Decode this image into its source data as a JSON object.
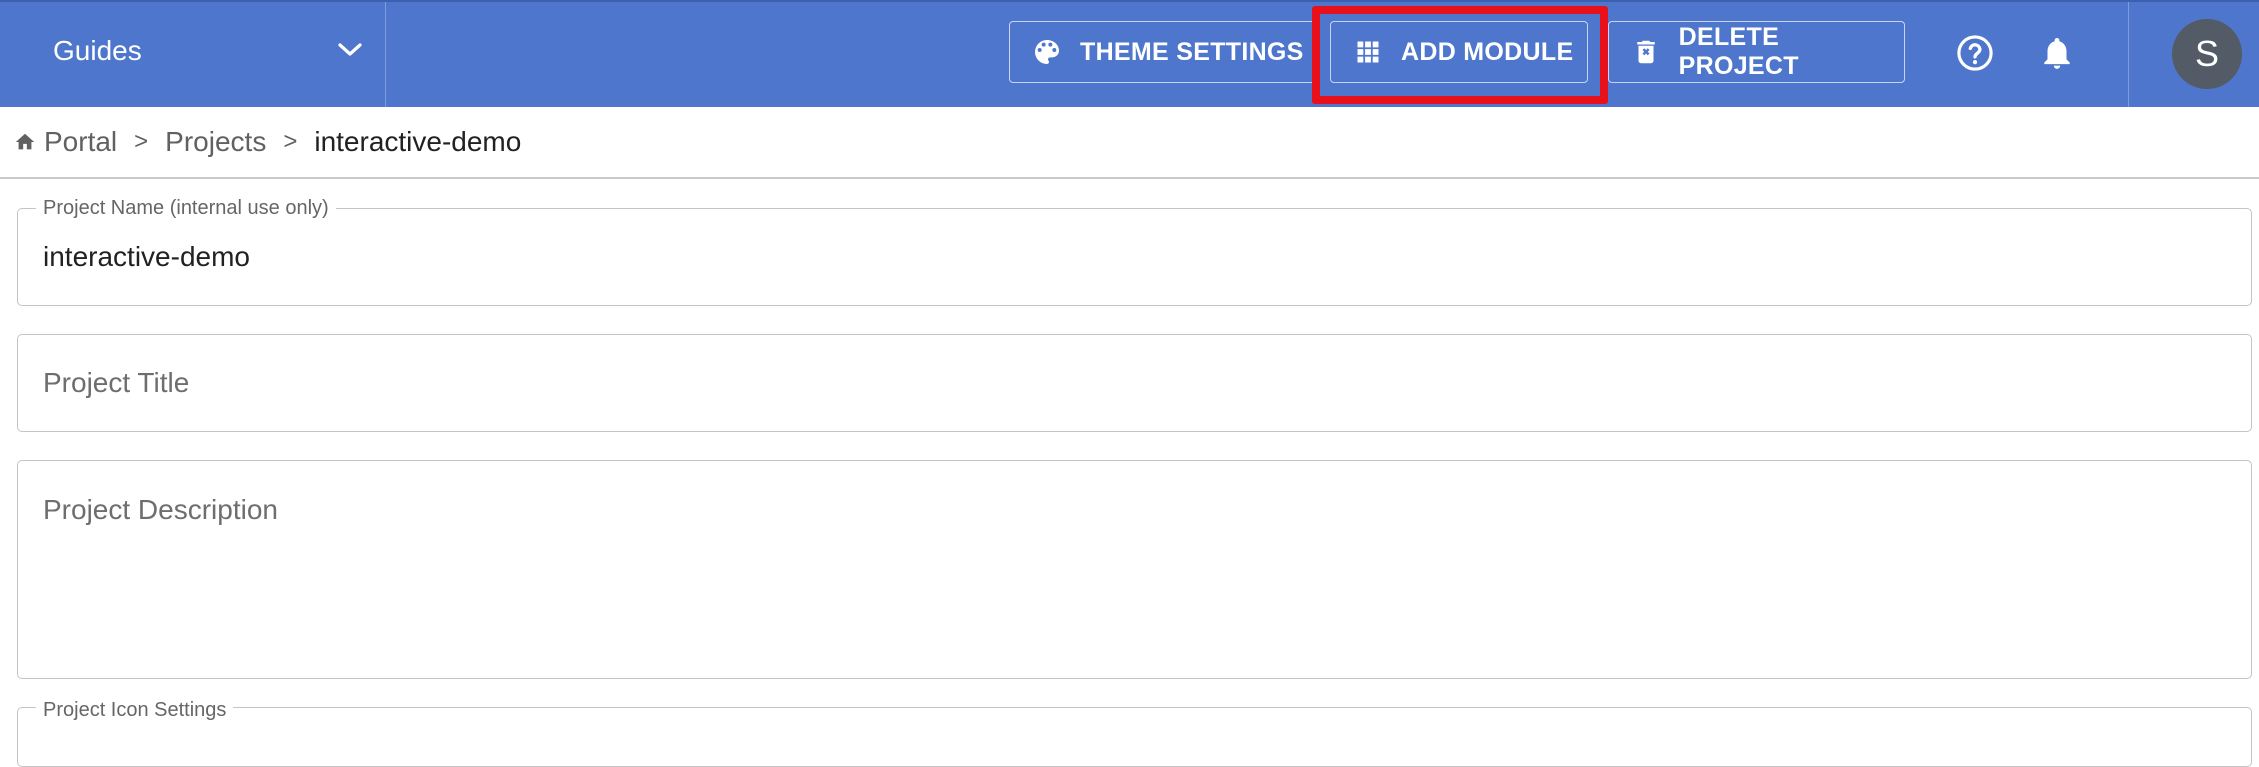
{
  "header": {
    "guides_label": "Guides",
    "theme_settings_label": "THEME SETTINGS",
    "add_module_label": "ADD MODULE",
    "delete_project_label": "DELETE PROJECT",
    "avatar_initial": "S",
    "bar_color": "#4d76cc",
    "highlight_color": "#e8101b"
  },
  "breadcrumb": {
    "items": [
      "Portal",
      "Projects",
      "interactive-demo"
    ],
    "separator": ">"
  },
  "form": {
    "project_name": {
      "label": "Project Name (internal use only)",
      "value": "interactive-demo"
    },
    "project_title": {
      "placeholder": "Project Title"
    },
    "project_description": {
      "placeholder": "Project Description"
    },
    "project_icon_settings": {
      "label": "Project Icon Settings"
    }
  },
  "icons": [
    "chevron-down-icon",
    "palette-icon",
    "grid-icon",
    "delete-icon",
    "help-circle-icon",
    "bell-icon",
    "home-icon"
  ]
}
